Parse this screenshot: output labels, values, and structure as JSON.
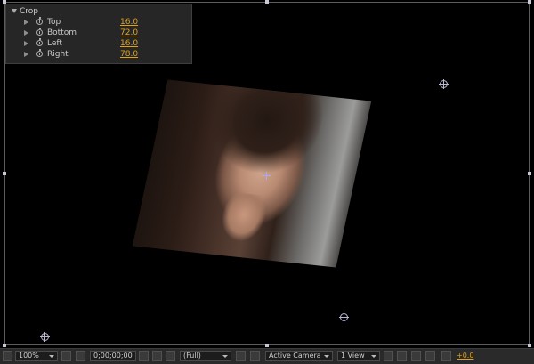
{
  "effect_controls": {
    "group": "Crop",
    "properties": [
      {
        "label": "Top",
        "value": "16.0"
      },
      {
        "label": "Bottom",
        "value": "72.0"
      },
      {
        "label": "Left",
        "value": "16.0"
      },
      {
        "label": "Right",
        "value": "78.0"
      }
    ]
  },
  "toolbar": {
    "zoom": "100%",
    "timecode": "0;00;00;00",
    "resolution": "(Full)",
    "camera": "Active Camera",
    "views": "1 View",
    "exposure": "+0.0"
  },
  "colors": {
    "accent_value": "#e0a21b",
    "viewer_bg": "#000000",
    "panel_bg": "#262626"
  }
}
